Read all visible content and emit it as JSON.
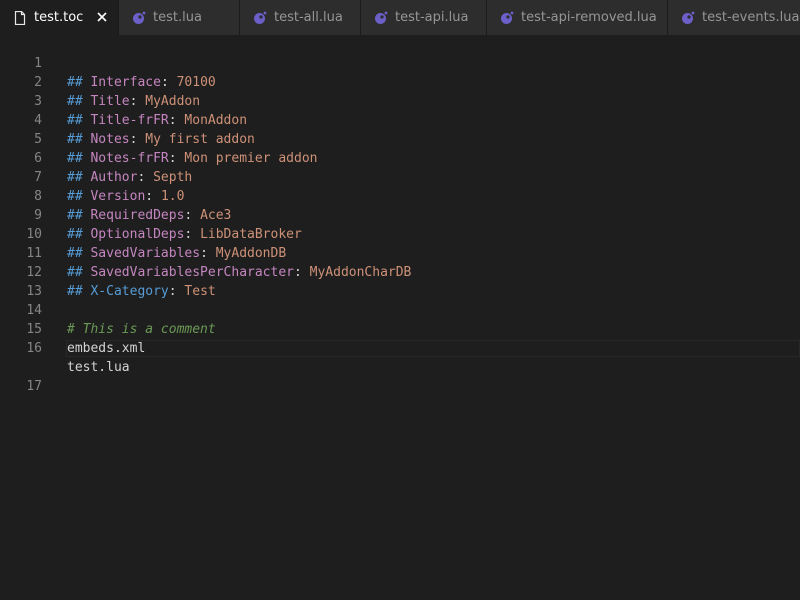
{
  "tabs": [
    {
      "label": "test.toc",
      "icon": "file-icon",
      "active": true
    },
    {
      "label": "test.lua",
      "icon": "lua-icon",
      "active": false
    },
    {
      "label": "test-all.lua",
      "icon": "lua-icon",
      "active": false
    },
    {
      "label": "test-api.lua",
      "icon": "lua-icon",
      "active": false
    },
    {
      "label": "test-api-removed.lua",
      "icon": "lua-icon",
      "active": false
    },
    {
      "label": "test-events.lua",
      "icon": "lua-icon",
      "active": false
    }
  ],
  "editor": {
    "lines": [
      {
        "n": "1",
        "prefix": "## ",
        "key": "Interface",
        "sep": ": ",
        "value": "70100"
      },
      {
        "n": "2",
        "prefix": "## ",
        "key": "Title",
        "sep": ": ",
        "value": "MyAddon"
      },
      {
        "n": "3",
        "prefix": "## ",
        "key": "Title-frFR",
        "sep": ": ",
        "value": "MonAddon"
      },
      {
        "n": "4",
        "prefix": "## ",
        "key": "Notes",
        "sep": ": ",
        "value": "My first addon"
      },
      {
        "n": "5",
        "prefix": "## ",
        "key": "Notes-frFR",
        "sep": ": ",
        "value": "Mon premier addon"
      },
      {
        "n": "6",
        "prefix": "## ",
        "key": "Author",
        "sep": ": ",
        "value": "Septh"
      },
      {
        "n": "7",
        "prefix": "## ",
        "key": "Version",
        "sep": ": ",
        "value": "1.0"
      },
      {
        "n": "8",
        "prefix": "## ",
        "key": "RequiredDeps",
        "sep": ": ",
        "value": "Ace3"
      },
      {
        "n": "9",
        "prefix": "## ",
        "key": "OptionalDeps",
        "sep": ": ",
        "value": "LibDataBroker"
      },
      {
        "n": "10",
        "prefix": "## ",
        "key": "SavedVariables",
        "sep": ": ",
        "value": "MyAddonDB"
      },
      {
        "n": "11",
        "prefix": "## ",
        "key": "SavedVariablesPerCharacter",
        "sep": ": ",
        "value": "MyAddonCharDB"
      },
      {
        "n": "12",
        "prefix": "## ",
        "key": "X-Category",
        "sep": ": ",
        "value": "Test",
        "x_key": true
      },
      {
        "n": "13",
        "text": ""
      },
      {
        "n": "14",
        "comment": "# This is a comment"
      },
      {
        "n": "15",
        "text": "embeds.xml"
      },
      {
        "n": "16",
        "text": "test.lua"
      },
      {
        "n": "17",
        "text": "",
        "current": true
      }
    ]
  },
  "colors": {
    "background": "#1e1e1e",
    "tab_bar": "#252526",
    "line_number": "#858585",
    "prefix": "#569cd6",
    "key": "#c586c0",
    "value": "#ce9178",
    "comment": "#6a9955",
    "text": "#d4d4d4"
  }
}
